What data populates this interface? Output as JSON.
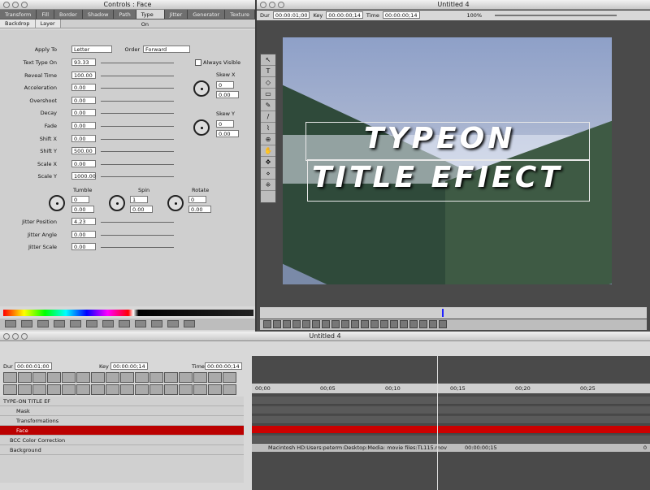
{
  "controls_window": {
    "title": "Controls : Face",
    "tabs": [
      "Transform",
      "Fill",
      "Border",
      "Shadow",
      "Path",
      "Type On",
      "Jitter",
      "Generator",
      "Texture"
    ],
    "subtabs": [
      "Backdrop",
      "Layer"
    ],
    "apply_to_label": "Apply To",
    "apply_to_value": "Letter",
    "order_label": "Order",
    "order_value": "Forward",
    "always_visible": "Always Visible",
    "params": [
      {
        "label": "Text Type On",
        "value": "93.33"
      },
      {
        "label": "Reveal Time",
        "value": "100.00"
      },
      {
        "label": "Acceleration",
        "value": "0.00"
      },
      {
        "label": "Overshoot",
        "value": "0.00"
      },
      {
        "label": "Decay",
        "value": "0.00"
      },
      {
        "label": "Fade",
        "value": "0.00"
      },
      {
        "label": "Shift X",
        "value": "0.00"
      },
      {
        "label": "Shift Y",
        "value": "500.00"
      },
      {
        "label": "Scale X",
        "value": "0.00"
      },
      {
        "label": "Scale Y",
        "value": "1000.00"
      }
    ],
    "skew_x": {
      "label": "Skew X",
      "a": "0",
      "b": "0.00"
    },
    "skew_y": {
      "label": "Skew Y",
      "a": "0",
      "b": "0.00"
    },
    "tumble": {
      "label": "Tumble",
      "a": "0",
      "b": "0.00"
    },
    "spin": {
      "label": "Spin",
      "a": "1",
      "b": "0.00"
    },
    "rotate": {
      "label": "Rotate",
      "a": "0",
      "b": "0.00"
    },
    "jitter": [
      {
        "label": "Jitter Position",
        "value": "4.23"
      },
      {
        "label": "Jitter Angle",
        "value": "0.00"
      },
      {
        "label": "Jitter Scale",
        "value": "0.00"
      }
    ]
  },
  "viewer_window": {
    "title": "Untitled 4",
    "dur_label": "Dur",
    "dur_value": "00:00:01;00",
    "key_label": "Key",
    "key_value": "00:00:00;14",
    "time_label": "Time",
    "time_value": "00:00:00;14",
    "zoom": "100%",
    "title_line1": "TYPEON",
    "title_line2": "TITLE EFIECT"
  },
  "timeline_window": {
    "title": "Untitled 4",
    "dur_label": "Dur",
    "dur_value": "00:00:01;00",
    "key_label": "Key",
    "key_value": "00:00:00;14",
    "time_label": "Time",
    "time_value": "00:00:00;14",
    "ruler": [
      "00;00",
      "00;05",
      "00;10",
      "00;15",
      "00;20",
      "00;25"
    ],
    "tracks": [
      "TYPE-ON TITLE EF",
      "Mask",
      "Transformations",
      "Face",
      "BCC Color Correction",
      "Background"
    ],
    "media_path": "Macintosh HD:Users:peterm:Desktop:Media: movie files:TL115.mov",
    "media_time": "00:00:00;15",
    "media_end": "0"
  }
}
